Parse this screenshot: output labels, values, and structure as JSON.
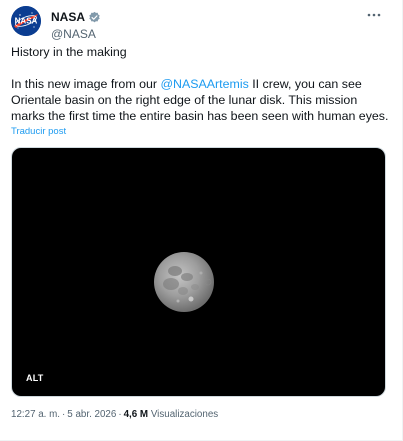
{
  "author": {
    "display_name": "NASA",
    "handle": "@NASA",
    "verified": true,
    "avatar_icon": "nasa-meatball-logo",
    "logo_text": "NASA"
  },
  "header": {
    "more_icon": "more-dots-icon"
  },
  "tweet": {
    "line1": "History in the making",
    "para2_prefix": "In this new image from our ",
    "mention": "@NASAArtemis",
    "para2_suffix": " II crew, you can see Orientale basin on the right edge of the lunar disk. This mission marks the first time the entire basin has been seen with human eyes.",
    "translate_label": "Traducir post"
  },
  "media": {
    "alt_label": "ALT",
    "subject_icon": "moon-image"
  },
  "meta": {
    "time": "12:27 a. m.",
    "separator": "·",
    "date": "5 abr. 2026",
    "views_count": "4,6 M",
    "views_label": "Visualizaciones"
  },
  "colors": {
    "link": "#1d9bf0",
    "text": "#0f1419",
    "secondary": "#536471",
    "verified_badge": "#829aab"
  }
}
